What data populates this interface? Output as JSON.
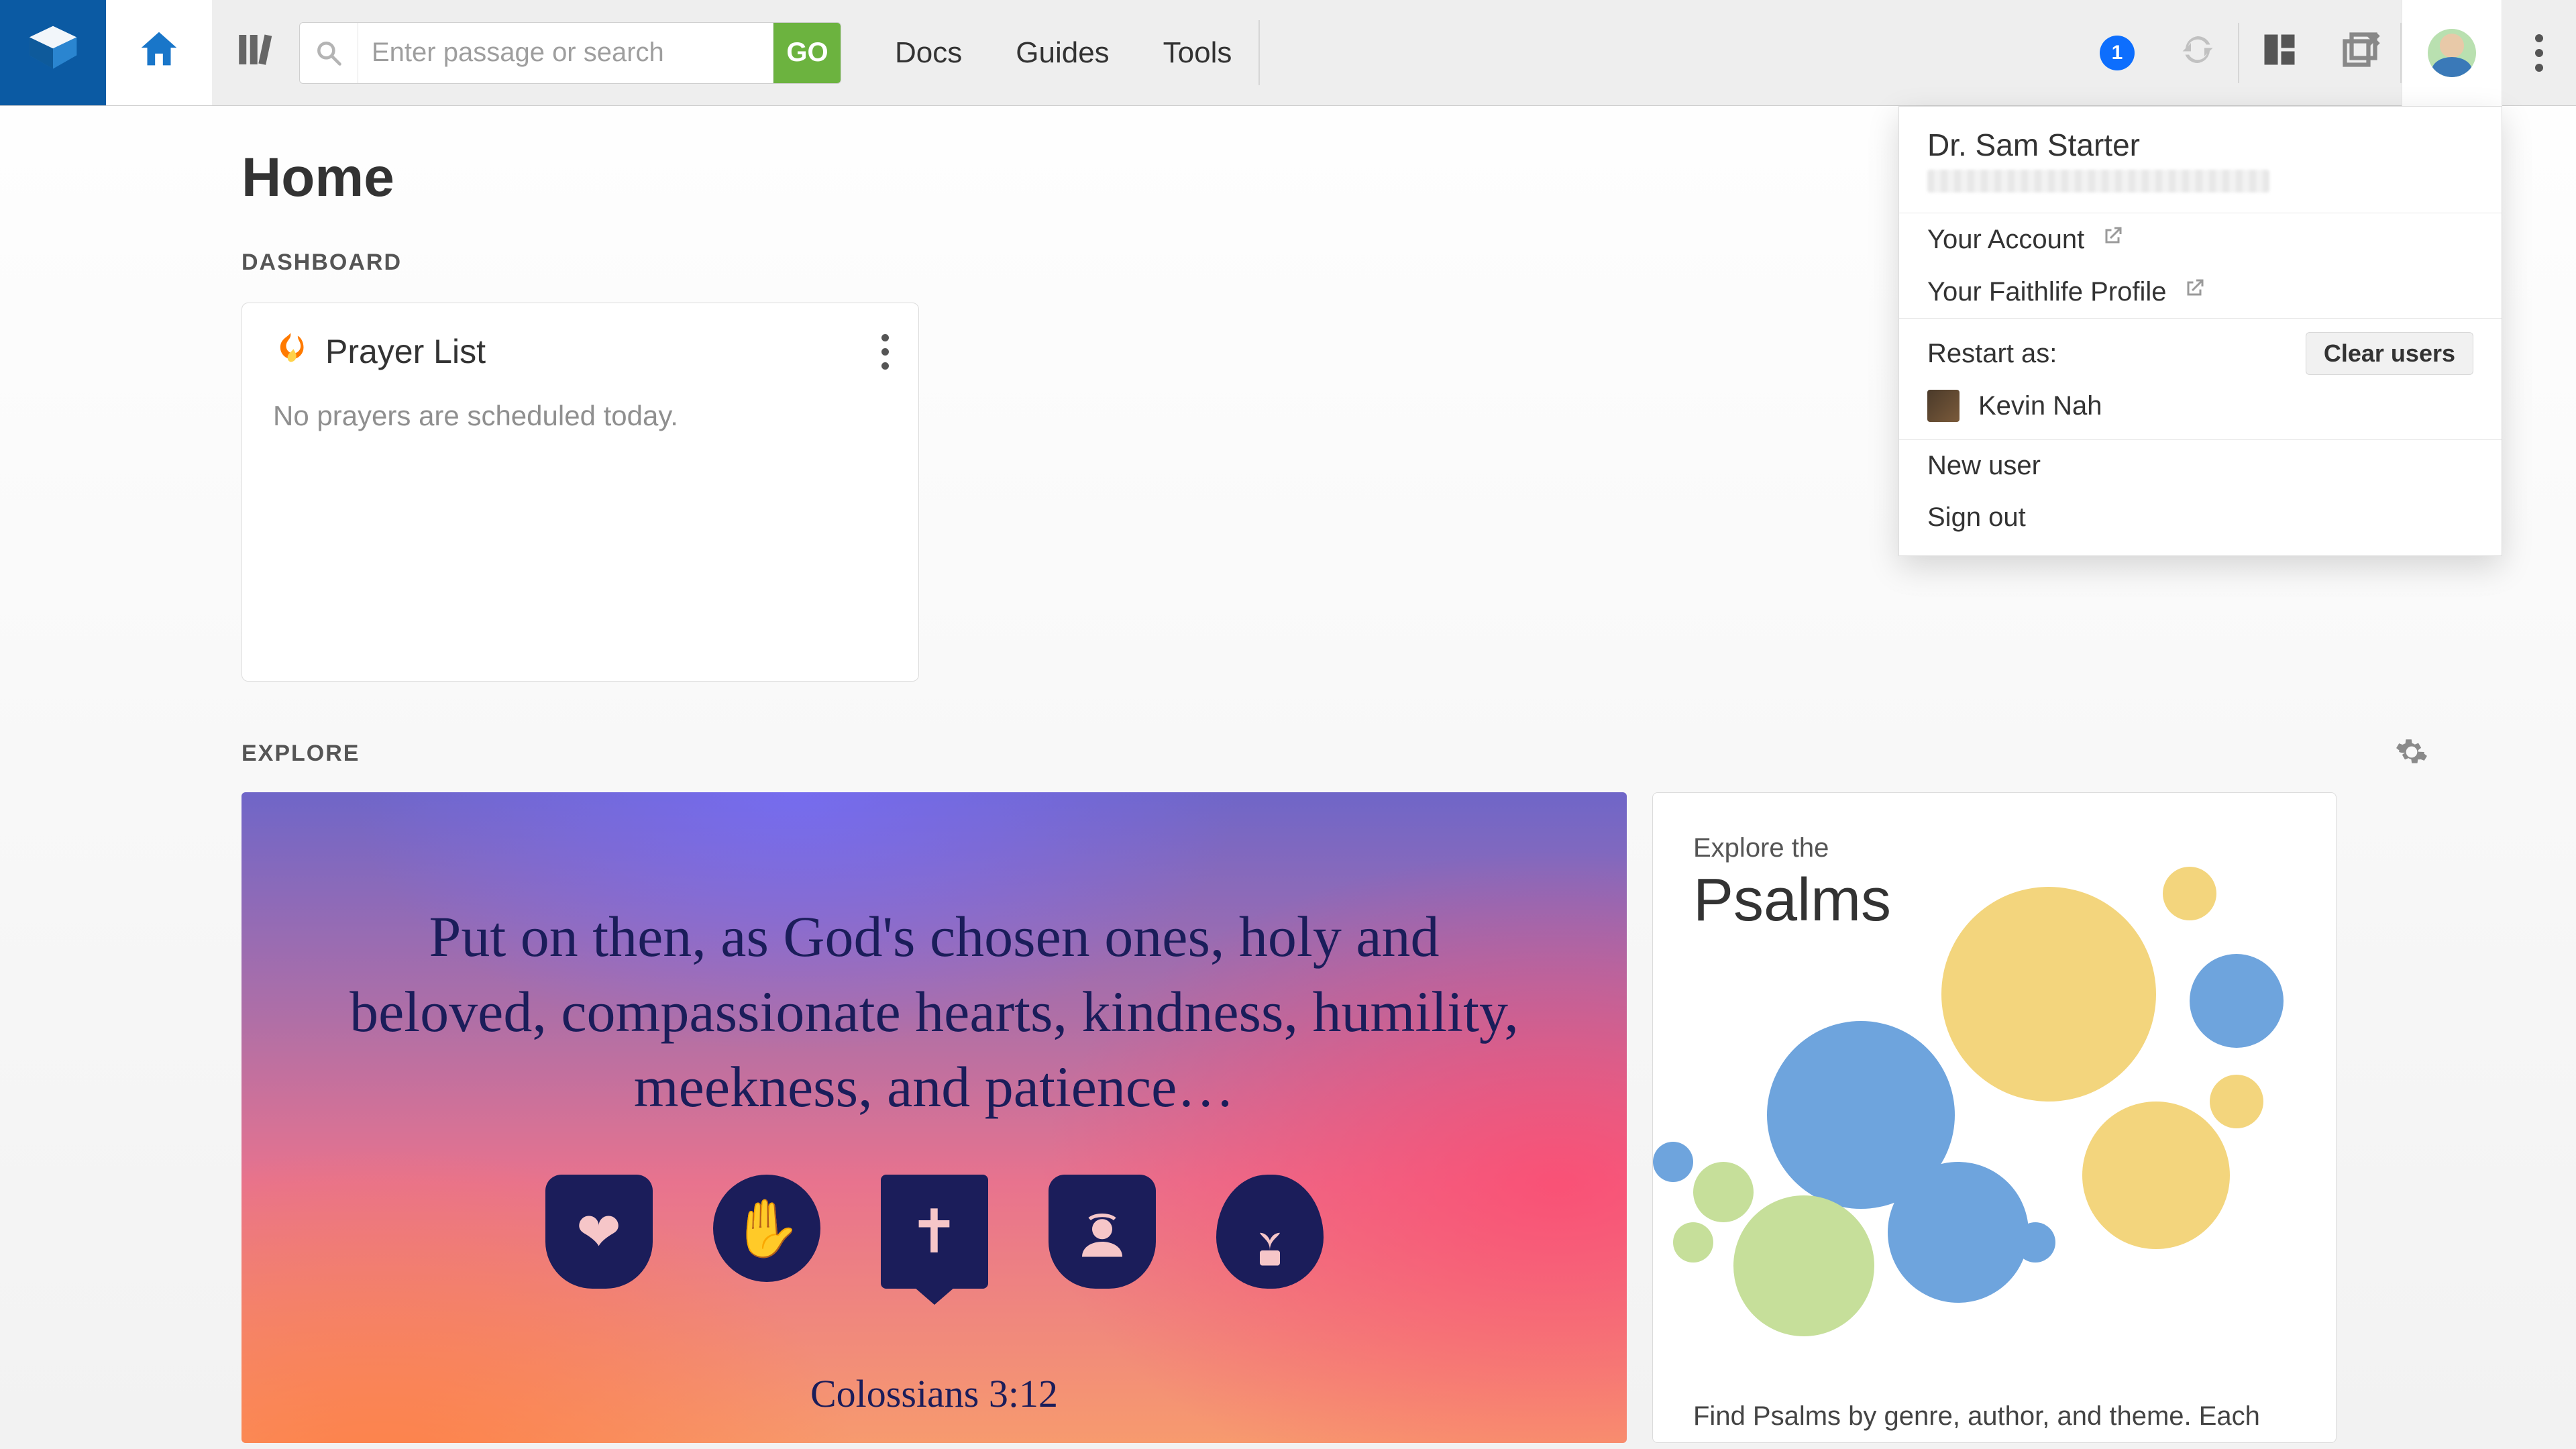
{
  "toolbar": {
    "search_placeholder": "Enter passage or search",
    "go_label": "GO",
    "menu": {
      "docs": "Docs",
      "guides": "Guides",
      "tools": "Tools"
    },
    "notification_count": "1"
  },
  "page": {
    "title": "Home",
    "dashboard_label": "DASHBOARD",
    "explore_label": "EXPLORE"
  },
  "dashboard": {
    "prayer": {
      "title": "Prayer List",
      "empty_msg": "No prayers are scheduled today."
    }
  },
  "explore": {
    "hero": {
      "verse": "Put on then, as God's chosen ones, holy and beloved, compassionate hearts, kindness, humility, meekness, and patience…",
      "reference": "Colossians 3:12"
    },
    "psalms": {
      "pretitle": "Explore the",
      "title": "Psalms",
      "description": "Find Psalms by genre, author, and theme. Each"
    }
  },
  "user_menu": {
    "name": "Dr. Sam Starter",
    "your_account": "Your Account",
    "your_profile": "Your Faithlife Profile",
    "restart_label": "Restart as:",
    "clear_users": "Clear users",
    "alt_user": "Kevin Nah",
    "new_user": "New user",
    "sign_out": "Sign out"
  }
}
